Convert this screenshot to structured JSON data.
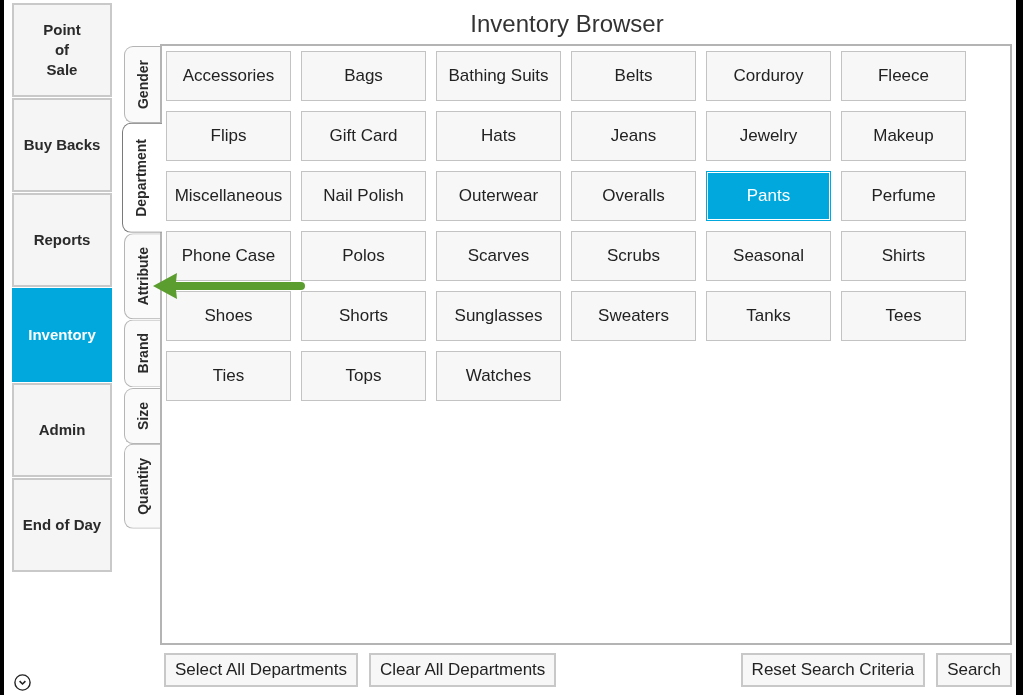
{
  "title": "Inventory Browser",
  "nav": [
    {
      "label": "Point\nof\nSale",
      "selected": false
    },
    {
      "label": "Buy Backs",
      "selected": false
    },
    {
      "label": "Reports",
      "selected": false
    },
    {
      "label": "Inventory",
      "selected": true
    },
    {
      "label": "Admin",
      "selected": false
    },
    {
      "label": "End of Day",
      "selected": false
    }
  ],
  "filter_tabs": [
    {
      "label": "Gender",
      "selected": false
    },
    {
      "label": "Department",
      "selected": true
    },
    {
      "label": "Attribute",
      "selected": false
    },
    {
      "label": "Brand",
      "selected": false
    },
    {
      "label": "Size",
      "selected": false
    },
    {
      "label": "Quantity",
      "selected": false
    }
  ],
  "departments": [
    {
      "label": "Accessories",
      "selected": false
    },
    {
      "label": "Bags",
      "selected": false
    },
    {
      "label": "Bathing Suits",
      "selected": false
    },
    {
      "label": "Belts",
      "selected": false
    },
    {
      "label": "Corduroy",
      "selected": false
    },
    {
      "label": "Fleece",
      "selected": false
    },
    {
      "label": "Flips",
      "selected": false
    },
    {
      "label": "Gift Card",
      "selected": false
    },
    {
      "label": "Hats",
      "selected": false
    },
    {
      "label": "Jeans",
      "selected": false
    },
    {
      "label": "Jewelry",
      "selected": false
    },
    {
      "label": "Makeup",
      "selected": false
    },
    {
      "label": "Miscellaneous",
      "selected": false
    },
    {
      "label": "Nail Polish",
      "selected": false
    },
    {
      "label": "Outerwear",
      "selected": false
    },
    {
      "label": "Overalls",
      "selected": false
    },
    {
      "label": "Pants",
      "selected": true
    },
    {
      "label": "Perfume",
      "selected": false
    },
    {
      "label": "Phone Case",
      "selected": false
    },
    {
      "label": "Polos",
      "selected": false
    },
    {
      "label": "Scarves",
      "selected": false
    },
    {
      "label": "Scrubs",
      "selected": false
    },
    {
      "label": "Seasonal",
      "selected": false
    },
    {
      "label": "Shirts",
      "selected": false
    },
    {
      "label": "Shoes",
      "selected": false
    },
    {
      "label": "Shorts",
      "selected": false
    },
    {
      "label": "Sunglasses",
      "selected": false
    },
    {
      "label": "Sweaters",
      "selected": false
    },
    {
      "label": "Tanks",
      "selected": false
    },
    {
      "label": "Tees",
      "selected": false
    },
    {
      "label": "Ties",
      "selected": false
    },
    {
      "label": "Tops",
      "selected": false
    },
    {
      "label": "Watches",
      "selected": false
    }
  ],
  "actions": {
    "left": [
      "Select All Departments",
      "Clear All Departments"
    ],
    "right": [
      "Reset Search Criteria",
      "Search"
    ]
  }
}
